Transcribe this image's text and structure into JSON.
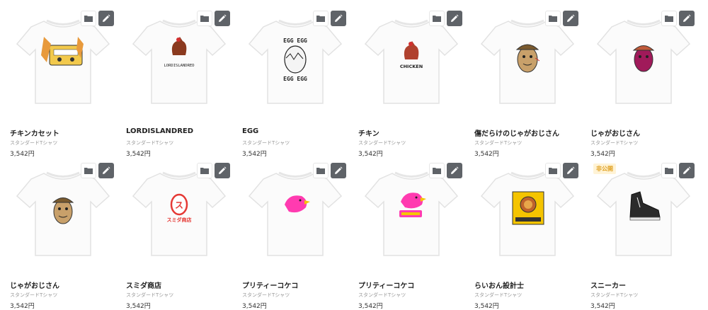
{
  "products": [
    {
      "title": "チキンカセット",
      "type": "スタンダードTシャツ",
      "price": "3,542円",
      "icon": "cassette-chicken-design"
    },
    {
      "title": "LORDISLANDRED",
      "type": "スタンダードTシャツ",
      "price": "3,542円",
      "icon": "rooster-text-design",
      "print_text": "LORDISLANDRED"
    },
    {
      "title": "EGG",
      "type": "スタンダードTシャツ",
      "price": "3,542円",
      "icon": "egg-text-design",
      "print_text": "EGG EGG"
    },
    {
      "title": "チキン",
      "type": "スタンダードTシャツ",
      "price": "3,542円",
      "icon": "chicken-text-design",
      "print_text": "CHICKEN"
    },
    {
      "title": "傷だらけのじゃがおじさん",
      "type": "スタンダードTシャツ",
      "price": "3,542円",
      "icon": "potato-man-design"
    },
    {
      "title": "じゃがおじさん",
      "type": "スタンダードTシャツ",
      "price": "3,542円",
      "icon": "purple-potato-design"
    },
    {
      "title": "じゃがおじさん",
      "type": "スタンダードTシャツ",
      "price": "3,542円",
      "icon": "potato-man-design"
    },
    {
      "title": "スミダ商店",
      "type": "スタンダードTシャツ",
      "price": "3,542円",
      "icon": "egg-logo-design",
      "print_text": "スミダ商店"
    },
    {
      "title": "プリティーコケコ",
      "type": "スタンダードTシャツ",
      "price": "3,542円",
      "icon": "pink-bird-design"
    },
    {
      "title": "プリティーコケコ",
      "type": "スタンダードTシャツ",
      "price": "3,542円",
      "icon": "pink-bird-label-design"
    },
    {
      "title": "らいおん設計士",
      "type": "スタンダードTシャツ",
      "price": "3,542円",
      "icon": "lion-yellow-design"
    },
    {
      "title": "スニーカー",
      "type": "スタンダードTシャツ",
      "price": "3,542円",
      "icon": "sneaker-design",
      "badge": "非公開"
    }
  ],
  "colors": {
    "edit_button": "#5f6368",
    "badge_text": "#e0a020",
    "accent_red": "#e53935",
    "pink": "#ff3bb0",
    "yellow": "#f5c400"
  }
}
